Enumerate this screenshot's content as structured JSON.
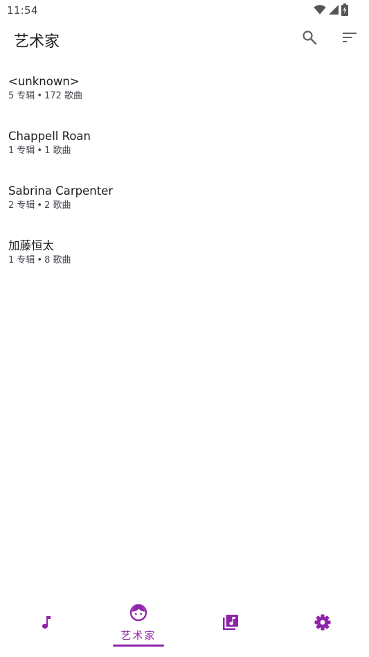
{
  "status_bar": {
    "time": "11:54",
    "icons": [
      "wifi-icon",
      "cell-signal-icon",
      "battery-charging-icon"
    ]
  },
  "app_bar": {
    "title": "艺术家",
    "actions": [
      "search-icon",
      "sort-icon"
    ]
  },
  "artists": [
    {
      "name": "<unknown>",
      "albums": "5 专辑",
      "songs": "172 歌曲"
    },
    {
      "name": "Chappell Roan",
      "albums": "1 专辑",
      "songs": "1 歌曲"
    },
    {
      "name": "Sabrina Carpenter",
      "albums": "2 专辑",
      "songs": "2 歌曲"
    },
    {
      "name": "加藤恒太",
      "albums": "1 专辑",
      "songs": "8 歌曲"
    }
  ],
  "separator": "•",
  "bottom_nav": {
    "items": [
      {
        "icon": "music-note-icon",
        "label": "",
        "active": false
      },
      {
        "icon": "artist-face-icon",
        "label": "艺术家",
        "active": true
      },
      {
        "icon": "album-library-icon",
        "label": "",
        "active": false
      },
      {
        "icon": "settings-gear-icon",
        "label": "",
        "active": false
      }
    ]
  },
  "colors": {
    "accent": "#8e24aa",
    "text_primary": "#1c1b1f",
    "text_secondary": "#49454f",
    "icon_gray": "#5f6368"
  }
}
